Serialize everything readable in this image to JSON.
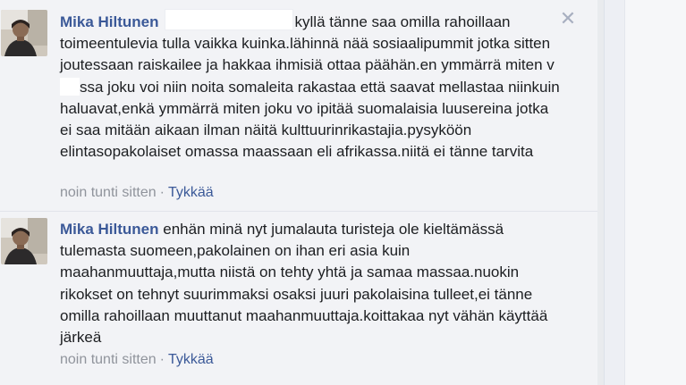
{
  "comments": [
    {
      "author": "Mika Hiltunen",
      "segments": [
        "kyllä tänne saa omilla rahoillaan toimeentulevia tulla vaikka kuinka.lähinnä nää sosiaalipummit jotka sitten joutessaan raiskailee ja hakkaa ihmisiä ottaa päähän.en ymmärrä miten v",
        "ssa joku voi niin noita somaleita rakastaa että saavat mellastaa niinkuin haluavat,enkä ymmärrä miten joku vo ipitää suomalaisia luusereina jotka ei saa mitään aikaan ilman näitä kulttuurinrikastajia.pysyköön elintasopakolaiset omassa maassaan eli afrikassa.niitä ei tänne tarvita"
      ],
      "time": "noin tunti sitten",
      "separator": "·",
      "like": "Tykkää",
      "close_icon": "close-icon"
    },
    {
      "author": "Mika Hiltunen",
      "body": "enhän minä nyt jumalauta turisteja ole kieltämässä tulemasta suomeen,pakolainen on ihan eri asia kuin maahanmuuttaja,mutta niistä on tehty yhtä ja samaa massaa.nuokin rikokset on tehnyt suurimmaksi osaksi juuri pakolaisina tulleet,ei tänne omilla rahoillaan muuttanut maahanmuuttaja.koittakaa nyt vähän käyttää järkeä",
      "time": "noin tunti sitten",
      "separator": "·",
      "like": "Tykkää"
    }
  ],
  "colors": {
    "author": "#3b5998",
    "body_text": "#1c1e21",
    "meta": "#90949c",
    "background": "#f2f3f6"
  }
}
